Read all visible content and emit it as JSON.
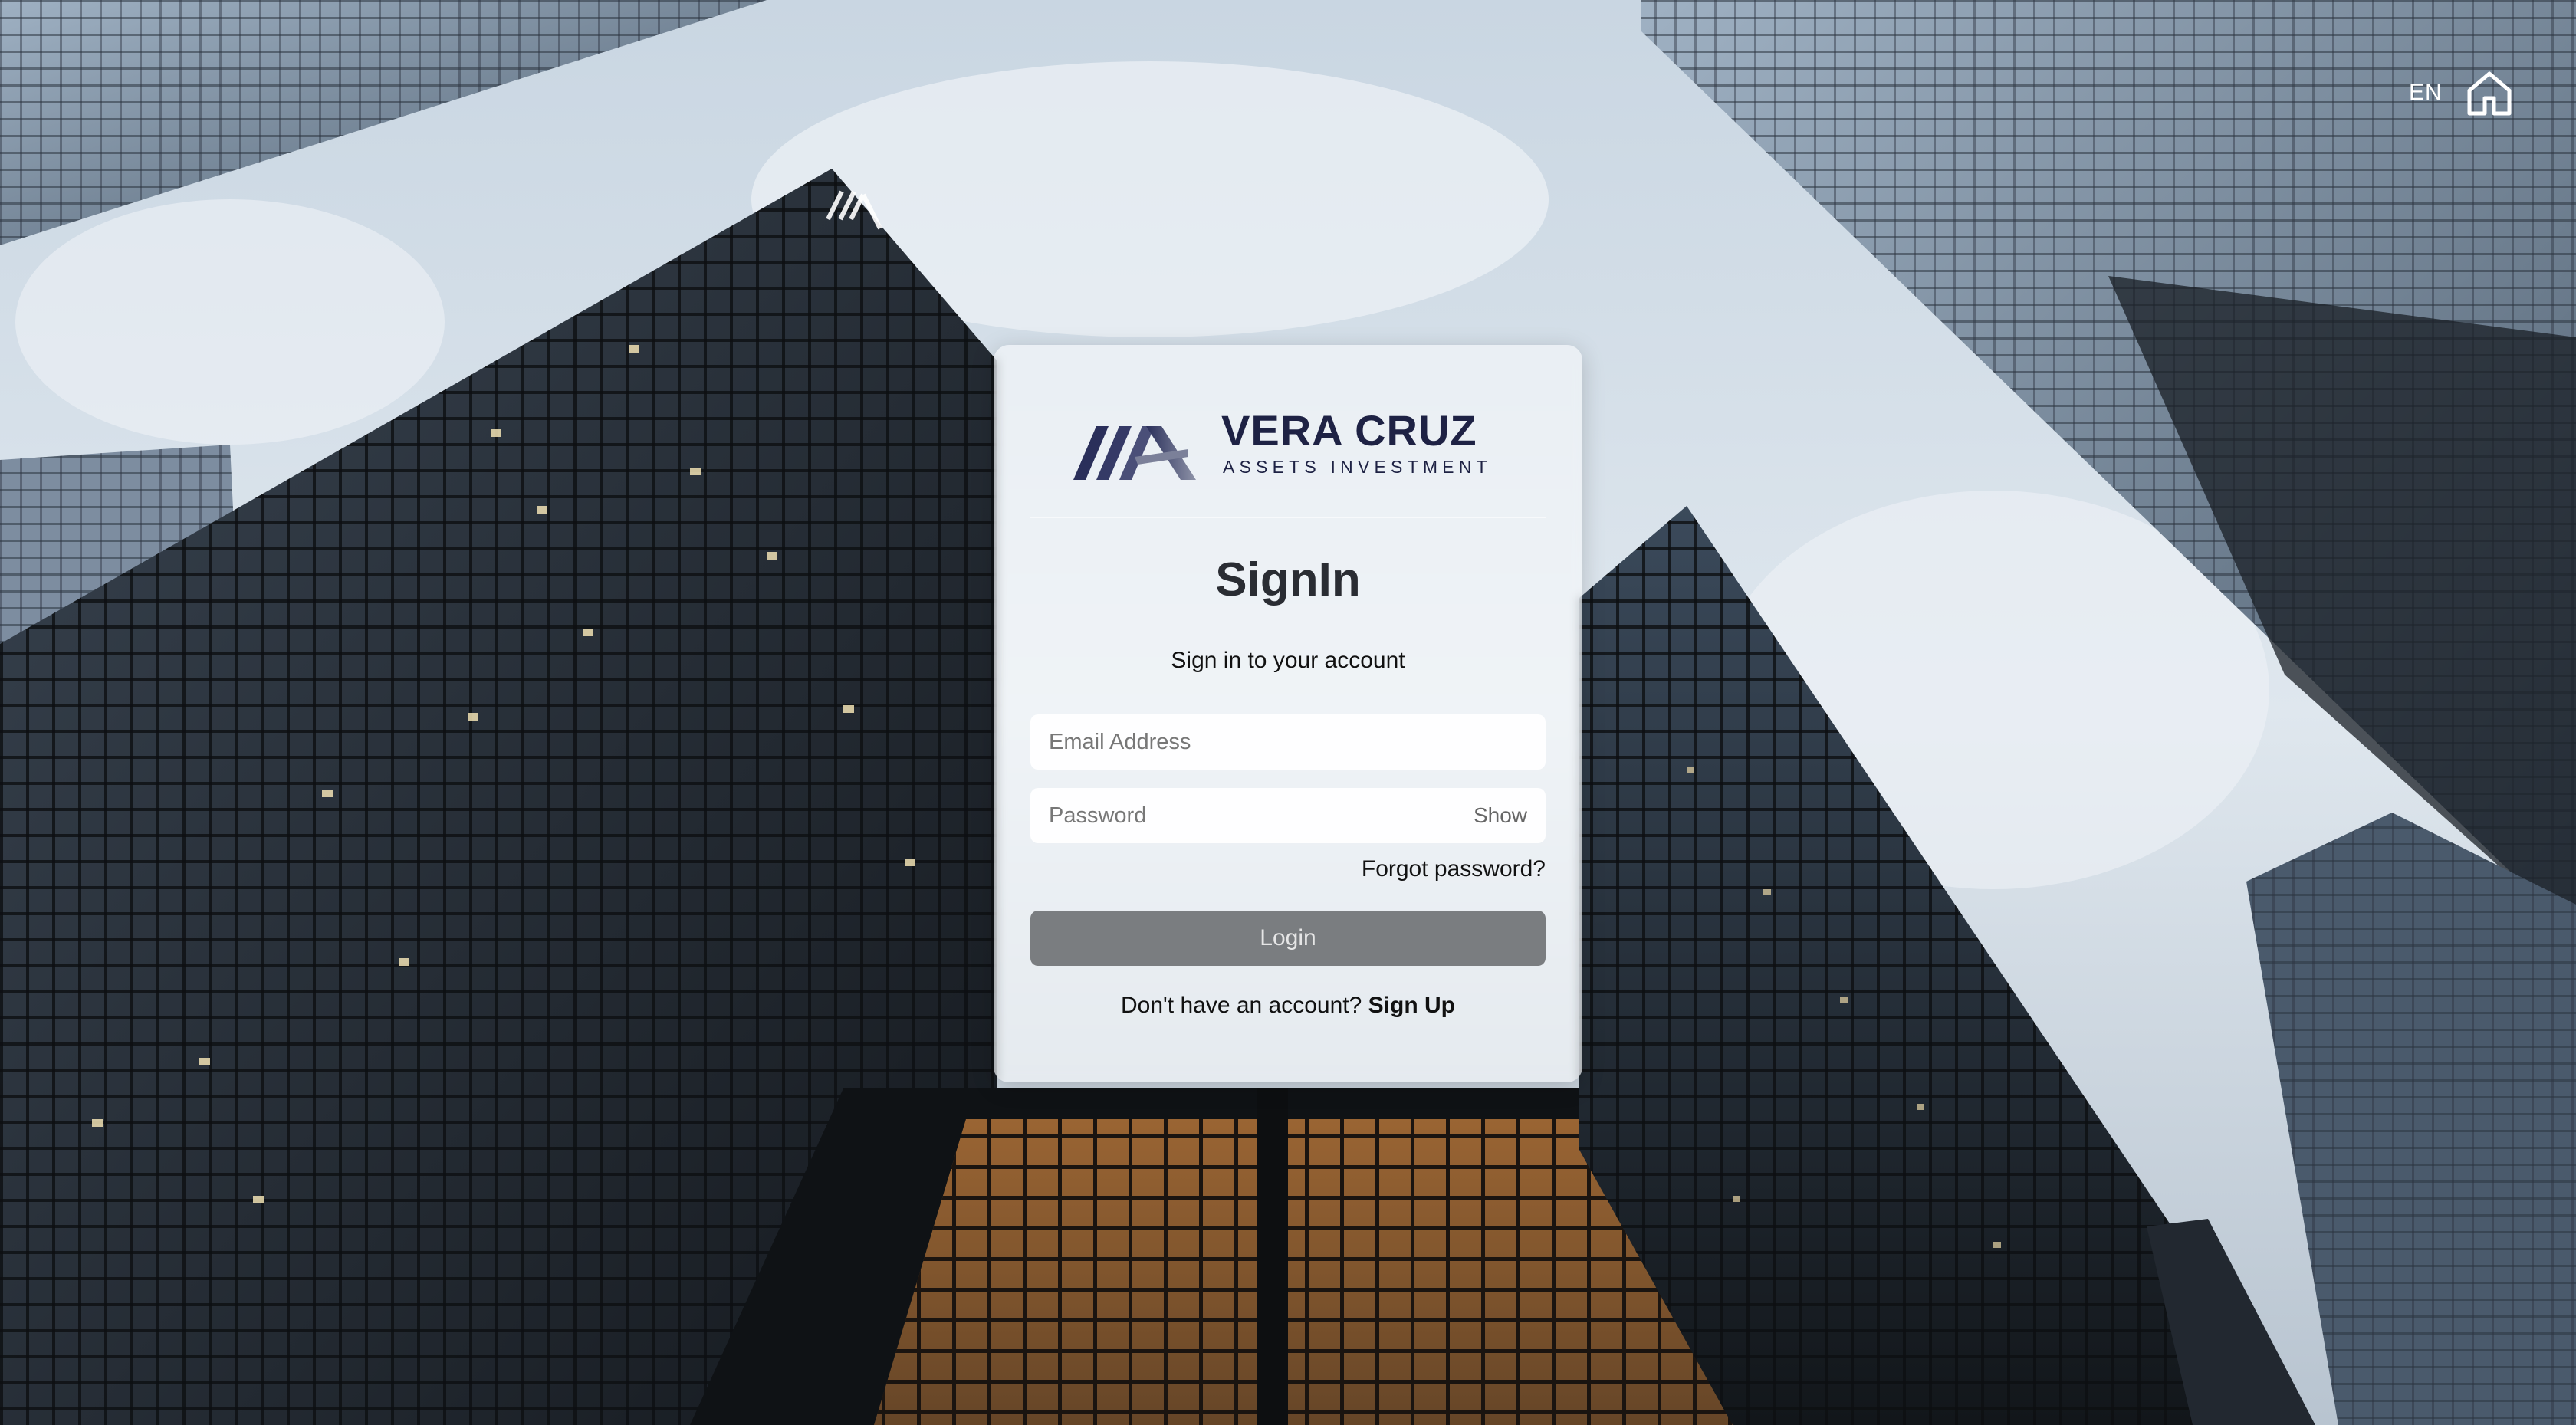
{
  "header": {
    "language": "EN",
    "home_icon": "home-icon"
  },
  "brand": {
    "name": "VERA CRUZ",
    "tagline": "ASSETS INVESTMENT",
    "logo_icon": "vera-cruz-logo-icon"
  },
  "form": {
    "title": "SignIn",
    "subtitle": "Sign in to your account",
    "email_placeholder": "Email Address",
    "password_placeholder": "Password",
    "show_label": "Show",
    "forgot_label": "Forgot password?",
    "login_label": "Login",
    "signup_prompt": "Don't have an account?",
    "signup_label": "Sign Up"
  },
  "colors": {
    "brand_navy": "#1e2244",
    "login_button": "#7a7d80"
  }
}
